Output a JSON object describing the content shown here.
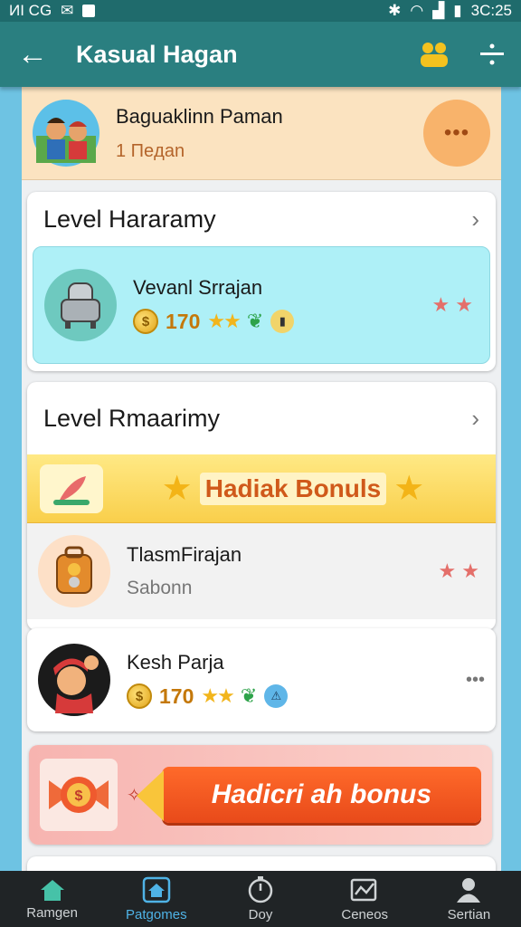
{
  "status": {
    "left": "ИI CG",
    "time": "3C:25"
  },
  "appbar": {
    "title": "Kasual Hagan"
  },
  "profile": {
    "name": "Baguaklinn Paman",
    "sub": "1 Пeдan",
    "more": "•••"
  },
  "section1": {
    "title": "Level Hararamy",
    "item": {
      "name": "Vevanl Srrajan",
      "coins": "170"
    }
  },
  "section2": {
    "title": "Level Rmaarimy",
    "bonus_label": "Hadiak Bonuls",
    "item1": {
      "name": "TlasmFirajan",
      "sub": "Sabonn"
    },
    "item2": {
      "name": "Kesh Parja",
      "coins": "170",
      "more": "•••"
    }
  },
  "promo": {
    "label": "Hadicri ah bonus"
  },
  "tabs": [
    {
      "label": "Ramgen",
      "icon": "home-icon"
    },
    {
      "label": "Patgomes",
      "icon": "home-outline-icon"
    },
    {
      "label": "Doy",
      "icon": "timer-icon"
    },
    {
      "label": "Ceneos",
      "icon": "chart-icon"
    },
    {
      "label": "Sertian",
      "icon": "person-icon"
    }
  ],
  "active_tab": 1,
  "colors": {
    "appbar": "#2a7f80",
    "accent": "#4fb3e6",
    "promo": "#e84a1a"
  }
}
